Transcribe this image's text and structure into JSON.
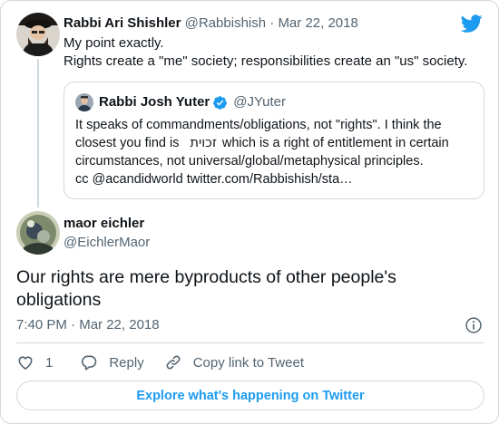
{
  "colors": {
    "twitter_blue": "#1d9bf0",
    "text_primary": "#0f1419",
    "text_secondary": "#536471",
    "border": "#cfd9de",
    "verified_blue": "#1d9bf0"
  },
  "parent_tweet": {
    "author_name": "Rabbi Ari Shishler",
    "author_handle": "@Rabbishish",
    "separator": "·",
    "date": "Mar 22, 2018",
    "line1": "My point exactly.",
    "line2": "Rights create a \"me\" society; responsibilities create an \"us\" society.",
    "avatar_icon": "profile-photo-rabbi-ari-shishler"
  },
  "quoted_tweet": {
    "author_name": "Rabbi Josh Yuter",
    "verified_icon": "verified-badge-icon",
    "author_handle": "@JYuter",
    "line1": "It speaks of commandments/obligations, not \"rights\". I think the",
    "line2_start": "closest you find is",
    "hebrew_word": "זכוית",
    "line2_end": "which is a right of entitlement in certain",
    "line3": "circumstances, not universal/global/metaphysical principles.",
    "line4": "cc @acandidworld twitter.com/Rabbishish/sta…"
  },
  "main_tweet": {
    "author_name": "maor eichler",
    "author_handle": "@EichlerMaor",
    "text_line1": "Our rights are mere byproducts of other people's",
    "text_line2": "obligations",
    "time": "7:40 PM",
    "separator": "·",
    "date": "Mar 22, 2018"
  },
  "actions": {
    "like_count": "1",
    "reply_label": "Reply",
    "copy_link_label": "Copy link to Tweet"
  },
  "footer": {
    "explore_label": "Explore what's happening on Twitter"
  }
}
